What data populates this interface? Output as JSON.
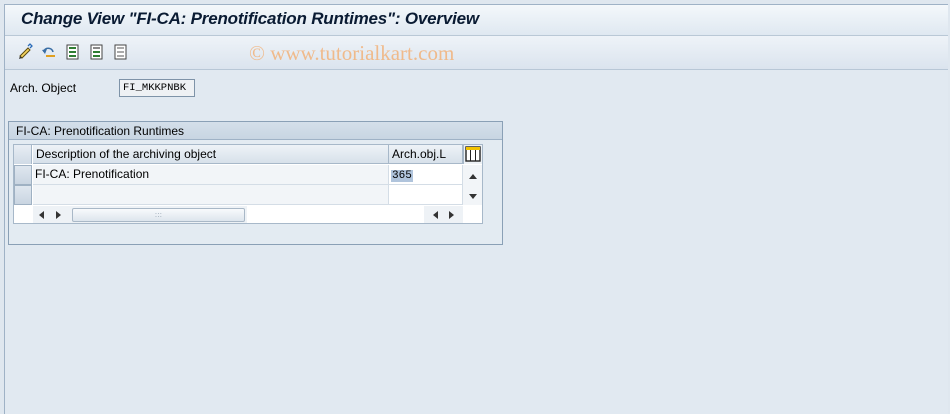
{
  "window": {
    "title": "Change View \"FI-CA: Prenotification Runtimes\": Overview",
    "watermark": "© www.tutorialkart.com"
  },
  "toolbar": {
    "icons": [
      "display-change-icon",
      "undo-icon",
      "select-all-icon",
      "select-block-icon",
      "deselect-all-icon"
    ]
  },
  "form": {
    "arch_object_label": "Arch. Object",
    "arch_object_value": "FI_MKKPNBK"
  },
  "group": {
    "title": "FI-CA: Prenotification Runtimes"
  },
  "table": {
    "columns": [
      "Description of the archiving object",
      "Arch.obj.L"
    ],
    "rows": [
      {
        "description": "FI-CA: Prenotification",
        "value": "365"
      },
      {
        "description": "",
        "value": ""
      }
    ]
  },
  "colors": {
    "background": "#dfe7ef",
    "selection": "#b0c4dc",
    "watermark": "#f2b27a"
  }
}
